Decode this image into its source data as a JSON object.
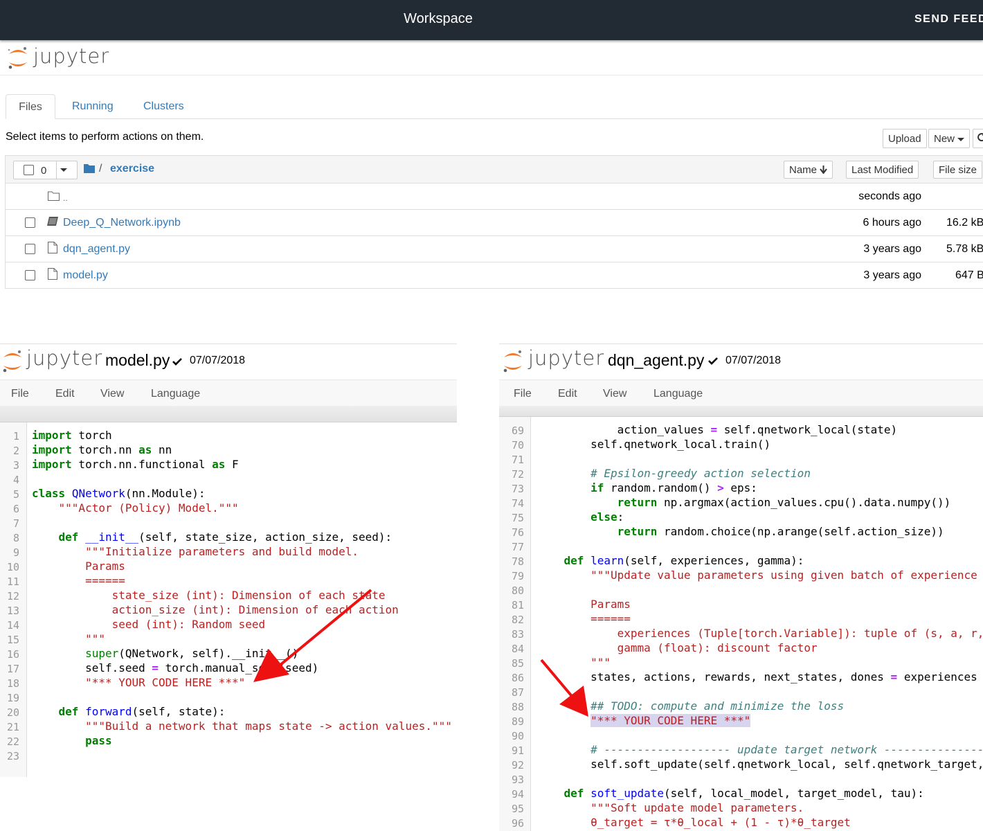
{
  "workspace": {
    "title": "Workspace",
    "feedback": "SEND FEED"
  },
  "jupyter": {
    "logo_text": "jupyter"
  },
  "tabs": [
    {
      "label": "Files"
    },
    {
      "label": "Running"
    },
    {
      "label": "Clusters"
    }
  ],
  "hint": "Select items to perform actions on them.",
  "toolbar": {
    "upload": "Upload",
    "new": "New"
  },
  "list_header": {
    "count": "0",
    "path_sep": "/",
    "folder": "exercise",
    "sort_name": "Name",
    "last_modified": "Last Modified",
    "file_size": "File size"
  },
  "files": [
    {
      "name": "..",
      "modified": "seconds ago",
      "size": "",
      "icon": "folder-icon"
    },
    {
      "name": "Deep_Q_Network.ipynb",
      "modified": "6 hours ago",
      "size": "16.2 kB",
      "icon": "notebook-icon"
    },
    {
      "name": "dqn_agent.py",
      "modified": "3 years ago",
      "size": "5.78 kB",
      "icon": "file-icon"
    },
    {
      "name": "model.py",
      "modified": "3 years ago",
      "size": "647 B",
      "icon": "file-icon"
    }
  ],
  "editor_left": {
    "filename": "model.py",
    "date": "07/07/2018"
  },
  "editor_right": {
    "filename": "dqn_agent.py",
    "date": "07/07/2018"
  },
  "editor_menu": [
    "File",
    "Edit",
    "View",
    "Language"
  ],
  "code_left": [
    "1",
    "2",
    "3",
    "4",
    "5",
    "6",
    "7",
    "8",
    "9",
    "10",
    "11",
    "12",
    "13",
    "14",
    "15",
    "16",
    "17",
    "18",
    "19",
    "20",
    "21",
    "22",
    "23"
  ],
  "code_right": [
    "69",
    "70",
    "71",
    "72",
    "73",
    "74",
    "75",
    "76",
    "77",
    "78",
    "79",
    "80",
    "81",
    "82",
    "83",
    "84",
    "85",
    "86",
    "87",
    "88",
    "89",
    "90",
    "91",
    "92",
    "93",
    "94",
    "95",
    "96"
  ]
}
